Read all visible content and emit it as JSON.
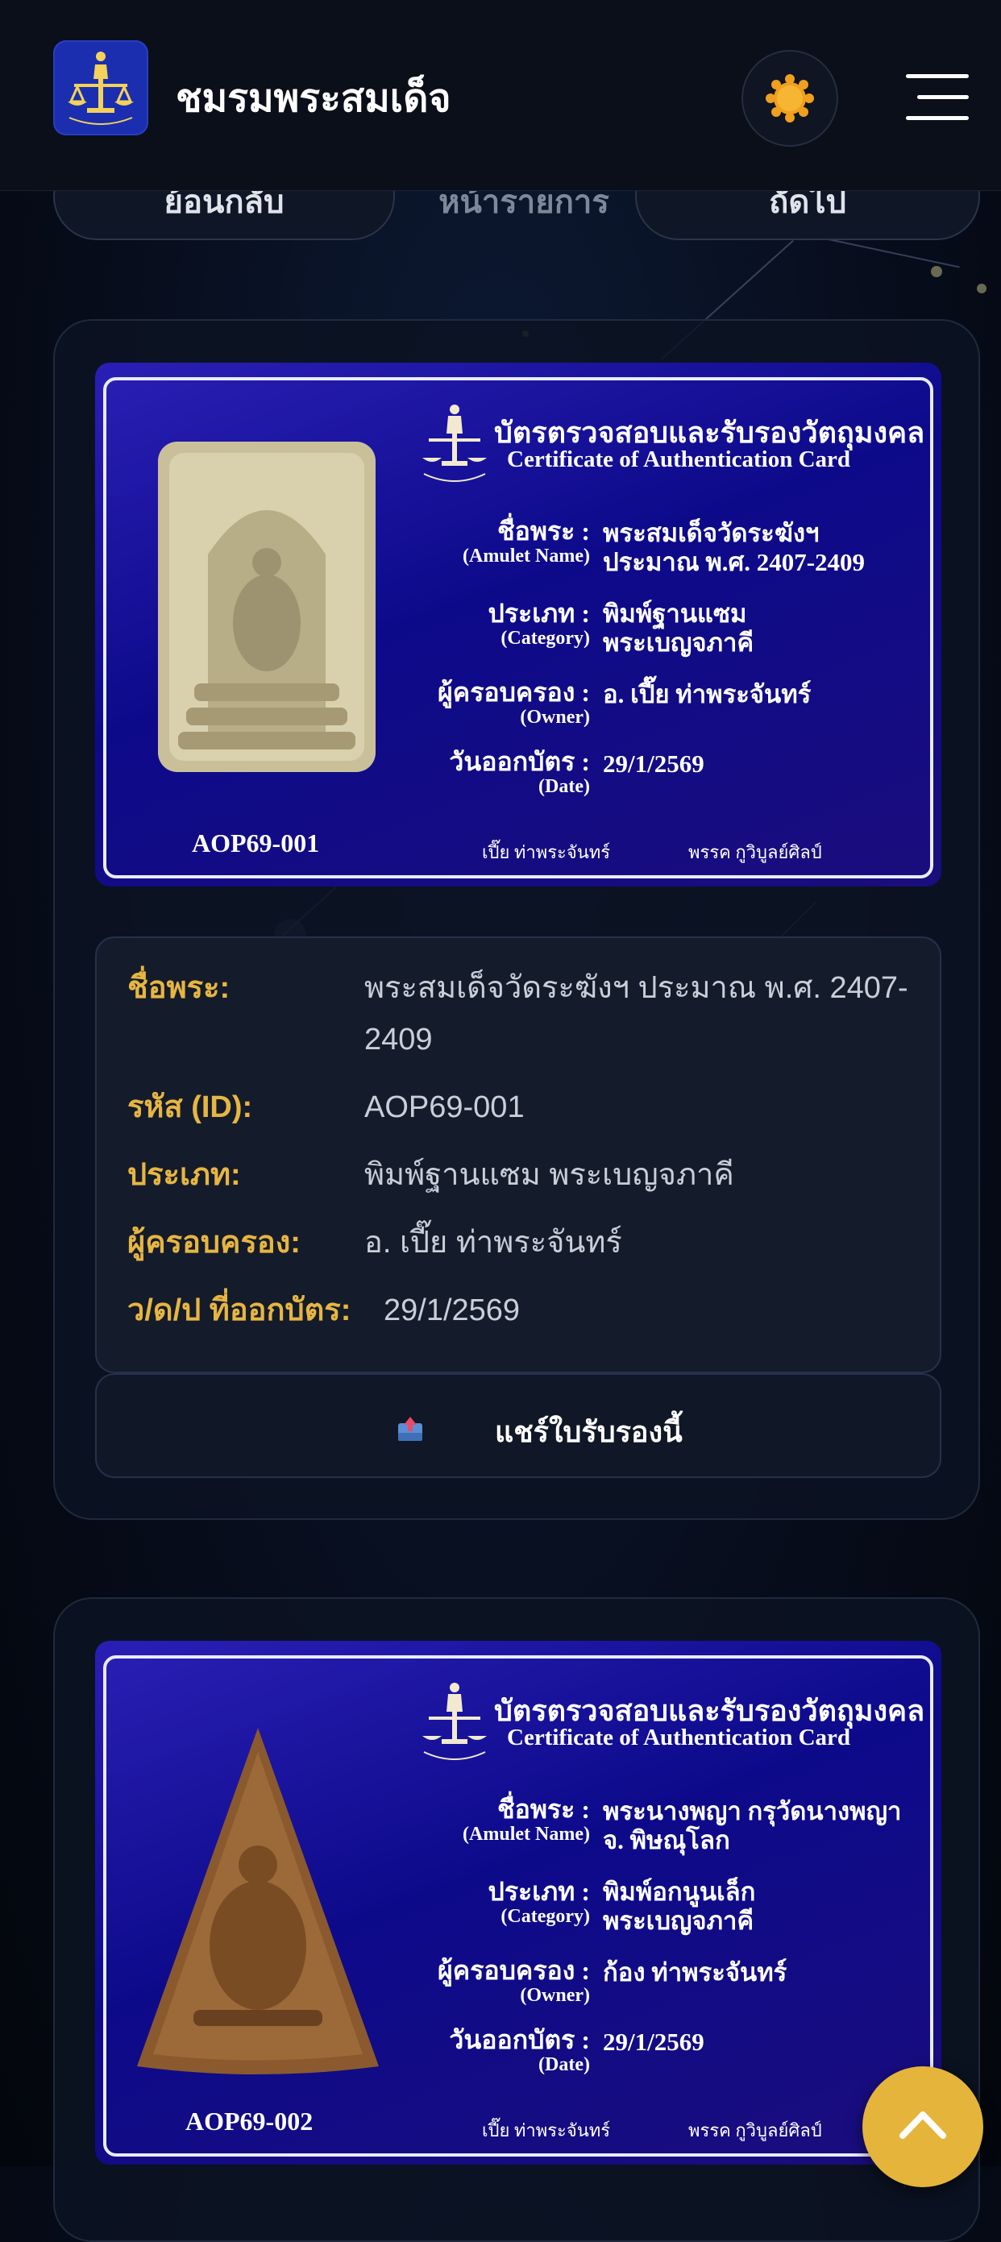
{
  "header": {
    "brand": "ชมรมพระสมเด็จ",
    "theme_icon": "sun-icon",
    "menu_icon": "hamburger-menu-icon"
  },
  "nav": {
    "back_label": "ย้อนกลับ",
    "middle_label": "หน้ารายการ",
    "next_label": "ถัดไป"
  },
  "certificate_common": {
    "title_th": "บัตรตรวจสอบและรับรองวัตถุมงคล",
    "title_en": "Certificate of Authentication Card",
    "lbl_name_th": "ชื่อพระ :",
    "lbl_name_en": "(Amulet Name)",
    "lbl_cat_th": "ประเภท :",
    "lbl_cat_en": "(Category)",
    "lbl_owner_th": "ผู้ครอบครอง :",
    "lbl_owner_en": "(Owner)",
    "lbl_date_th": "วันออกบัตร :",
    "lbl_date_en": "(Date)",
    "sign_left": "เปี๊ย ท่าพระจันทร์",
    "sign_right": "พรรค กูวิบูลย์ศิลป์"
  },
  "cards": [
    {
      "cert": {
        "name_line1": "พระสมเด็จวัดระฆังฯ",
        "name_line2": "ประมาณ พ.ศ. 2407-2409",
        "cat_line1": "พิมพ์ฐานแซม",
        "cat_line2": "พระเบญจภาคี",
        "owner": "อ. เปี๊ย ท่าพระจันทร์",
        "date": "29/1/2569",
        "code": "AOP69-001"
      },
      "info": {
        "name_label": "ชื่อพระ:",
        "name_value": "พระสมเด็จวัดระฆังฯ ประมาณ พ.ศ. 2407-2409",
        "id_label": "รหัส (ID):",
        "id_value": "AOP69-001",
        "category_label": "ประเภท:",
        "category_value": "พิมพ์ฐานแซม พระเบญจภาคี",
        "owner_label": "ผู้ครอบครอง:",
        "owner_value": "อ. เปี๊ย ท่าพระจันทร์",
        "date_label": "ว/ด/ป ที่ออกบัตร:",
        "date_value": "29/1/2569"
      },
      "share_label": "แชร์ใบรับรองนี้"
    },
    {
      "cert": {
        "name_line1": "พระนางพญา กรุวัดนางพญา",
        "name_line2": "จ. พิษณุโลก",
        "cat_line1": "พิมพ์อกนูนเล็ก",
        "cat_line2": "พระเบญจภาคี",
        "owner": "ก้อง ท่าพระจันทร์",
        "date": "29/1/2569",
        "code": "AOP69-002"
      }
    }
  ],
  "scroll_top_icon": "chevron-up-icon"
}
